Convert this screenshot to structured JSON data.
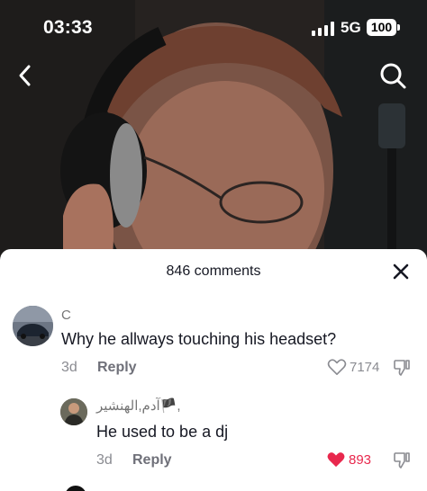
{
  "status_bar": {
    "time": "03:33",
    "network": "5G",
    "battery": "100"
  },
  "nav": {
    "back_icon": "chevron-left-icon",
    "search_icon": "search-icon"
  },
  "comments_panel": {
    "title": "846 comments",
    "close_icon": "close-icon",
    "comments": [
      {
        "username": "C",
        "text": "Why he allways touching his headset?",
        "age": "3d",
        "reply_label": "Reply",
        "likes": "7174",
        "liked": false
      },
      {
        "username": "آدم,الهنشير🏴,",
        "text": "He used to be a dj",
        "age": "3d",
        "reply_label": "Reply",
        "likes": "893",
        "liked": true
      }
    ]
  },
  "colors": {
    "accent_like": "#e8284d",
    "text_primary": "#161823",
    "text_secondary": "#8a8b91"
  }
}
